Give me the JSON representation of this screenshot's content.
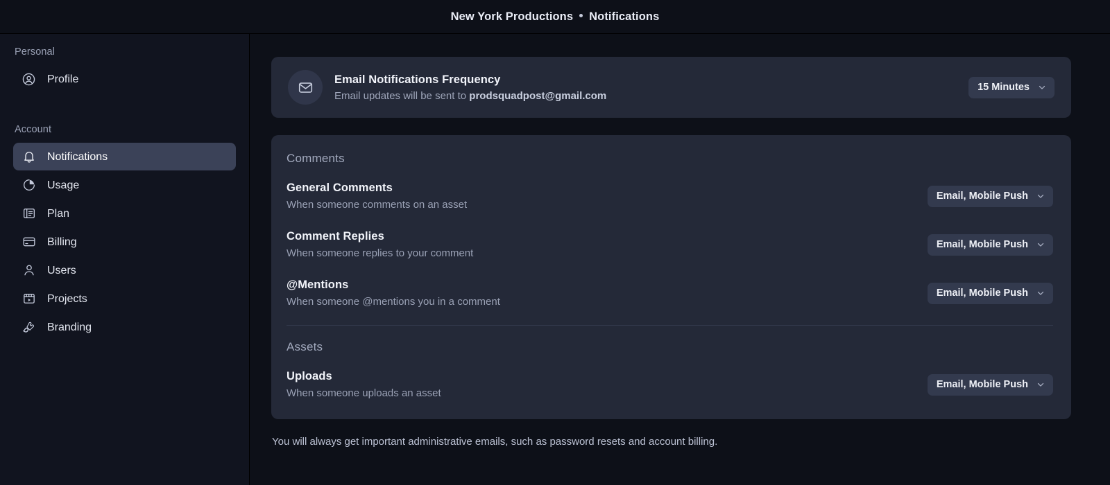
{
  "titlebar": {
    "workspace": "New York Productions",
    "page": "Notifications",
    "separator_icon": "bullet-dot-icon"
  },
  "sidebar": {
    "groups": [
      {
        "label": "Personal",
        "items": [
          {
            "label": "Profile",
            "icon": "user-circle-icon",
            "active": false
          }
        ]
      },
      {
        "label": "Account",
        "items": [
          {
            "label": "Notifications",
            "icon": "bell-icon",
            "active": true
          },
          {
            "label": "Usage",
            "icon": "pie-chart-icon",
            "active": false
          },
          {
            "label": "Plan",
            "icon": "book-icon",
            "active": false
          },
          {
            "label": "Billing",
            "icon": "credit-card-icon",
            "active": false
          },
          {
            "label": "Users",
            "icon": "user-icon",
            "active": false
          },
          {
            "label": "Projects",
            "icon": "clapperboard-icon",
            "active": false
          },
          {
            "label": "Branding",
            "icon": "brush-icon",
            "active": false
          }
        ]
      }
    ]
  },
  "main": {
    "email_frequency": {
      "icon": "envelope-icon",
      "title": "Email Notifications Frequency",
      "description_prefix": "Email updates will be sent to ",
      "email": "prodsquadpost@gmail.com",
      "dropdown_value": "15 Minutes",
      "dropdown_icon": "chevron-down-icon"
    },
    "sections": [
      {
        "heading": "Comments",
        "rows": [
          {
            "title": "General Comments",
            "description": "When someone comments on an asset",
            "dropdown_value": "Email, Mobile Push"
          },
          {
            "title": "Comment Replies",
            "description": "When someone replies to your comment",
            "dropdown_value": "Email, Mobile Push"
          },
          {
            "title": "@Mentions",
            "description": "When someone @mentions you in a comment",
            "dropdown_value": "Email, Mobile Push"
          }
        ]
      },
      {
        "heading": "Assets",
        "rows": [
          {
            "title": "Uploads",
            "description": "When someone uploads an asset",
            "dropdown_value": "Email, Mobile Push"
          }
        ]
      }
    ],
    "footnote": "You will always get important administrative emails, such as password resets and account billing."
  },
  "colors": {
    "page_background": "#0d1018",
    "sidebar_background": "#11141f",
    "card_background": "#242938",
    "active_item": "#3b4258",
    "pill_background": "#333a4e",
    "text_primary": "#f2f4fa",
    "text_muted": "#9aa1b5"
  }
}
